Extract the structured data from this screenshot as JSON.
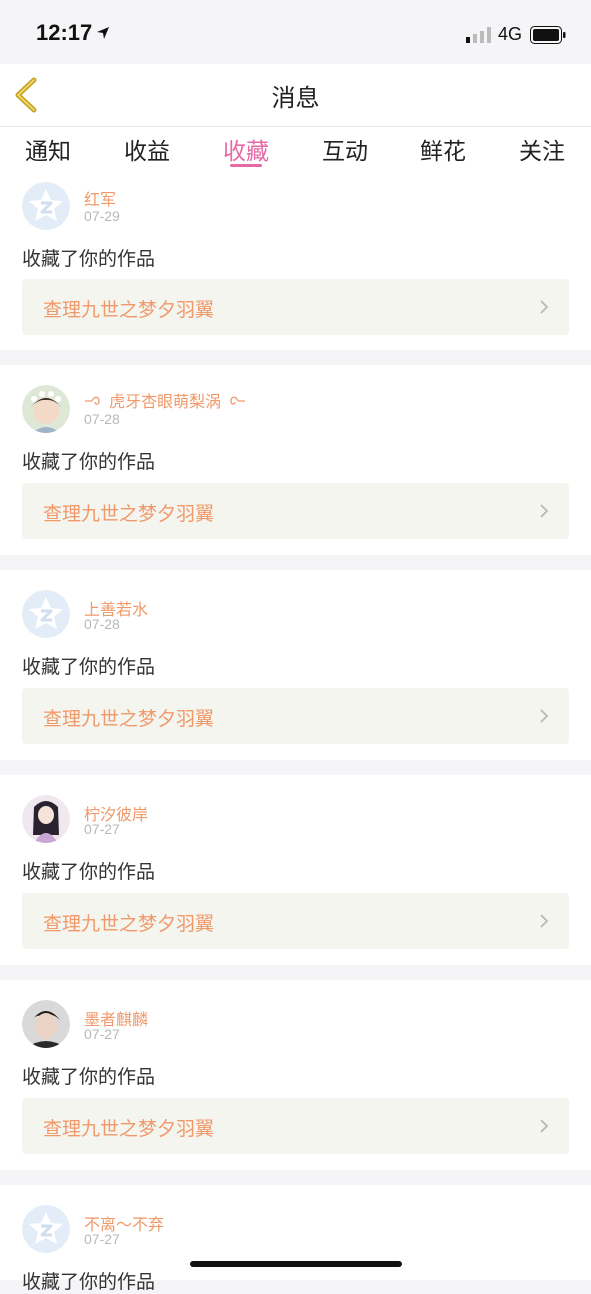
{
  "status_bar": {
    "time": "12:17",
    "network": "4G"
  },
  "nav": {
    "title": "消息"
  },
  "tabs": [
    {
      "label": "通知",
      "active": false
    },
    {
      "label": "收益",
      "active": false
    },
    {
      "label": "收藏",
      "active": true
    },
    {
      "label": "互动",
      "active": false
    },
    {
      "label": "鲜花",
      "active": false
    },
    {
      "label": "关注",
      "active": false
    }
  ],
  "colors": {
    "accent": "#e56aa6",
    "name": "#f0996a",
    "back_arrow": "#c9a628"
  },
  "items": [
    {
      "name": "红军",
      "date": "07-29",
      "action": "收藏了你的作品",
      "work": "查理九世之梦夕羽翼",
      "avatar": "default-star-avatar"
    },
    {
      "name": "虎牙杏眼萌梨涡",
      "date": "07-28",
      "action": "收藏了你的作品",
      "work": "查理九世之梦夕羽翼",
      "avatar": "photo-avatar"
    },
    {
      "name": "上善若水",
      "date": "07-28",
      "action": "收藏了你的作品",
      "work": "查理九世之梦夕羽翼",
      "avatar": "default-star-avatar"
    },
    {
      "name": "柠汐彼岸",
      "date": "07-27",
      "action": "收藏了你的作品",
      "work": "查理九世之梦夕羽翼",
      "avatar": "illustration-avatar"
    },
    {
      "name": "墨者麒麟",
      "date": "07-27",
      "action": "收藏了你的作品",
      "work": "查理九世之梦夕羽翼",
      "avatar": "photo-avatar"
    },
    {
      "name": "不离～不弃",
      "date": "07-27",
      "action": "收藏了你的作品",
      "work": "",
      "avatar": "default-star-avatar"
    }
  ]
}
